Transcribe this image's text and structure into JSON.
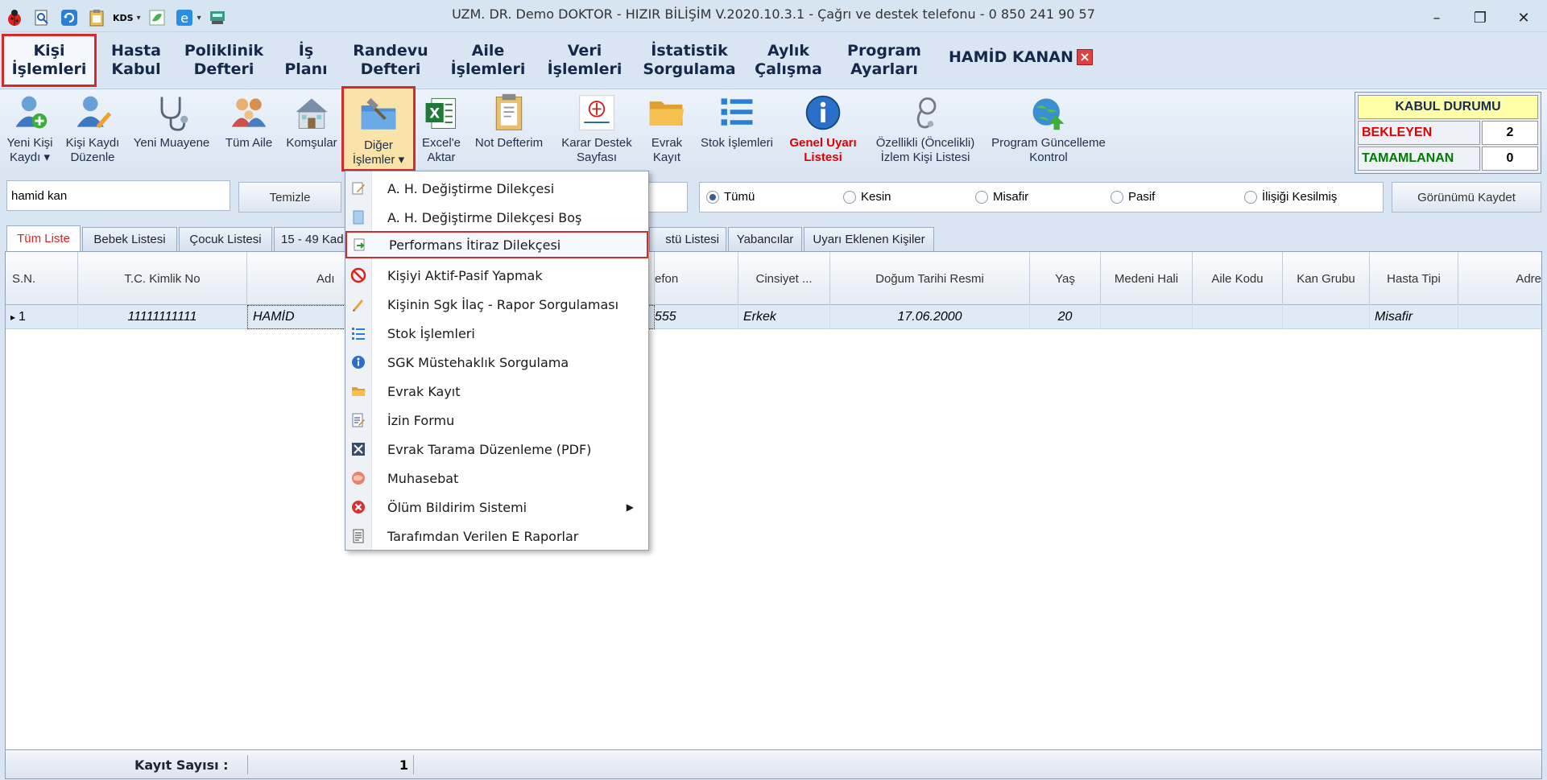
{
  "window": {
    "title": "UZM. DR. Demo DOKTOR - HIZIR BİLİŞİM V.2020.10.3.1 - Çağrı ve destek telefonu - 0 850 241 90 57",
    "qat_kds": "KDS",
    "minimize": "–",
    "restore": "❐",
    "close": "✕"
  },
  "menu": {
    "tabs": [
      "Kişi\nİşlemleri",
      "Hasta\nKabul",
      "Poliklinik\nDefteri",
      "İş\nPlanı",
      "Randevu\nDefteri",
      "Aile\nİşlemleri",
      "Veri\nİşlemleri",
      "İstatistik\nSorgulama",
      "Aylık\nÇalışma",
      "Program\nAyarları"
    ],
    "user": "HAMİD KANAN",
    "user_close": "×"
  },
  "ribbon": {
    "buttons": [
      "Yeni Kişi\nKaydı ▾",
      "Kişi Kaydı\nDüzenle",
      "Yeni Muayene",
      "Tüm Aile",
      "Komşular",
      "Diğer\nİşlemler ▾",
      "Excel'e\nAktar",
      "Not Defterim",
      "Karar Destek\nSayfası",
      "Evrak\nKayıt",
      "Stok İşlemleri",
      "Genel Uyarı\nListesi",
      "Özellikli (Öncelikli)\nİzlem Kişi Listesi",
      "Program Güncelleme\nKontrol"
    ]
  },
  "kabul": {
    "title": "KABUL DURUMU",
    "waiting_label": "BEKLEYEN",
    "waiting_value": "2",
    "done_label": "TAMAMLANAN",
    "done_value": "0",
    "waiting_color": "#e00000",
    "done_color": "#007a00"
  },
  "search": {
    "value": "hamid kan",
    "clear_label": "Temizle",
    "save_view_label": "Görünümü Kaydet"
  },
  "filters": {
    "options": [
      "Tümü",
      "Kesin",
      "Misafir",
      "Pasif",
      "İlişiği Kesilmiş"
    ],
    "selected": "Tümü"
  },
  "tabs": [
    "Tüm Liste",
    "Bebek Listesi",
    "Çocuk Listesi",
    "15 - 49 Kadı",
    "stü Listesi",
    "Yabancılar",
    "Uyarı Eklenen Kişiler"
  ],
  "grid": {
    "columns": [
      "S.N.",
      "T.C. Kimlik No",
      "Adı",
      "efon",
      "Cinsiyet ...",
      "Doğum Tarihi Resmi",
      "Yaş",
      "Medeni Hali",
      "Aile Kodu",
      "Kan Grubu",
      "Hasta Tipi",
      "Adre"
    ],
    "row": {
      "sn": "1",
      "tc": "11111111111",
      "name": "HAMİD",
      "phone": "555",
      "gender": "Erkek",
      "birth": "17.06.2000",
      "age": "20",
      "marital": "",
      "family_code": "",
      "blood": "",
      "patient_type": "Misafir",
      "address": ""
    },
    "row_marker": "▸"
  },
  "footer": {
    "label": "Kayıt Sayısı :",
    "count": "1"
  },
  "dropdown": {
    "items": [
      {
        "label": "A. H. Değiştirme Dilekçesi",
        "icon": "edit-doc-icon"
      },
      {
        "label": "A. H. Değiştirme Dilekçesi Boş",
        "icon": "blank-doc-icon"
      },
      {
        "label": "Performans İtiraz Dilekçesi",
        "icon": "export-doc-icon"
      },
      {
        "label": "Kişiyi Aktif-Pasif Yapmak",
        "icon": "no-entry-icon"
      },
      {
        "label": "Kişinin Sgk İlaç - Rapor Sorgulaması",
        "icon": "pen-icon"
      },
      {
        "label": "Stok İşlemleri",
        "icon": "list-icon"
      },
      {
        "label": "SGK Müstehaklık Sorgulama",
        "icon": "info-icon"
      },
      {
        "label": "Evrak Kayıt",
        "icon": "folder-icon"
      },
      {
        "label": "İzin Formu",
        "icon": "form-icon"
      },
      {
        "label": "Evrak Tarama Düzenleme (PDF)",
        "icon": "scan-icon"
      },
      {
        "label": "Muhasebat",
        "icon": "globe-icon"
      },
      {
        "label": "Ölüm Bildirim Sistemi",
        "icon": "red-x-icon"
      },
      {
        "label": "Tarafımdan Verilen E Raporlar",
        "icon": "report-icon"
      }
    ],
    "selected_index": 2,
    "submenu_arrow": "▶"
  }
}
